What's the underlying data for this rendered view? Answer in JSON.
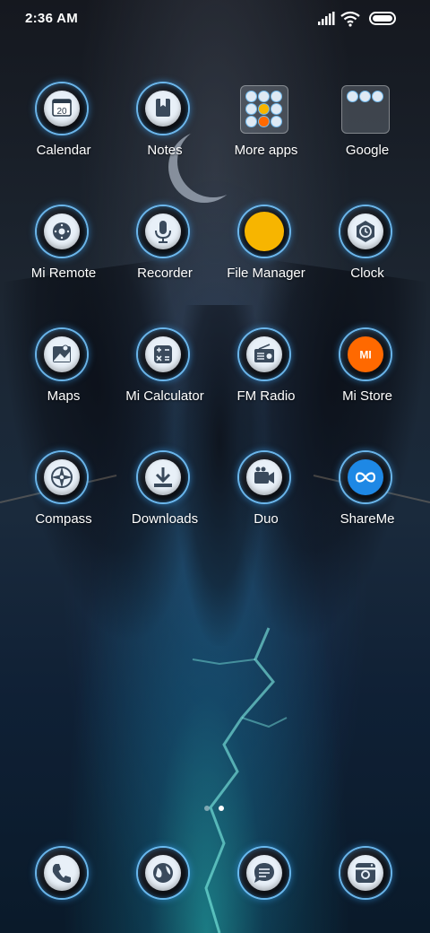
{
  "status_bar": {
    "time": "2:36 AM"
  },
  "apps": [
    {
      "label": "Calendar",
      "icon": "calendar-icon",
      "badge_text": "20"
    },
    {
      "label": "Notes",
      "icon": "notes-icon"
    },
    {
      "label": "More apps",
      "icon": "folder-icon"
    },
    {
      "label": "Google",
      "icon": "folder-icon"
    },
    {
      "label": "Mi Remote",
      "icon": "remote-icon"
    },
    {
      "label": "Recorder",
      "icon": "microphone-icon"
    },
    {
      "label": "File Manager",
      "icon": "file-manager-icon"
    },
    {
      "label": "Clock",
      "icon": "clock-icon"
    },
    {
      "label": "Maps",
      "icon": "map-icon"
    },
    {
      "label": "Mi Calculator",
      "icon": "calculator-icon"
    },
    {
      "label": "FM Radio",
      "icon": "radio-icon"
    },
    {
      "label": "Mi Store",
      "icon": "mi-store-icon",
      "badge_text": "MI"
    },
    {
      "label": "Compass",
      "icon": "compass-icon"
    },
    {
      "label": "Downloads",
      "icon": "download-icon"
    },
    {
      "label": "Duo",
      "icon": "video-camera-icon"
    },
    {
      "label": "ShareMe",
      "icon": "shareme-icon"
    }
  ],
  "dock": [
    {
      "icon": "phone-icon"
    },
    {
      "icon": "browser-icon"
    },
    {
      "icon": "messages-icon"
    },
    {
      "icon": "camera-icon"
    }
  ],
  "page_indicator": {
    "pages": 2,
    "current": 2
  },
  "colors": {
    "accent_glow": "#3cb0ff",
    "file_manager_yellow": "#f7b500",
    "mi_store_orange": "#ff6900"
  }
}
